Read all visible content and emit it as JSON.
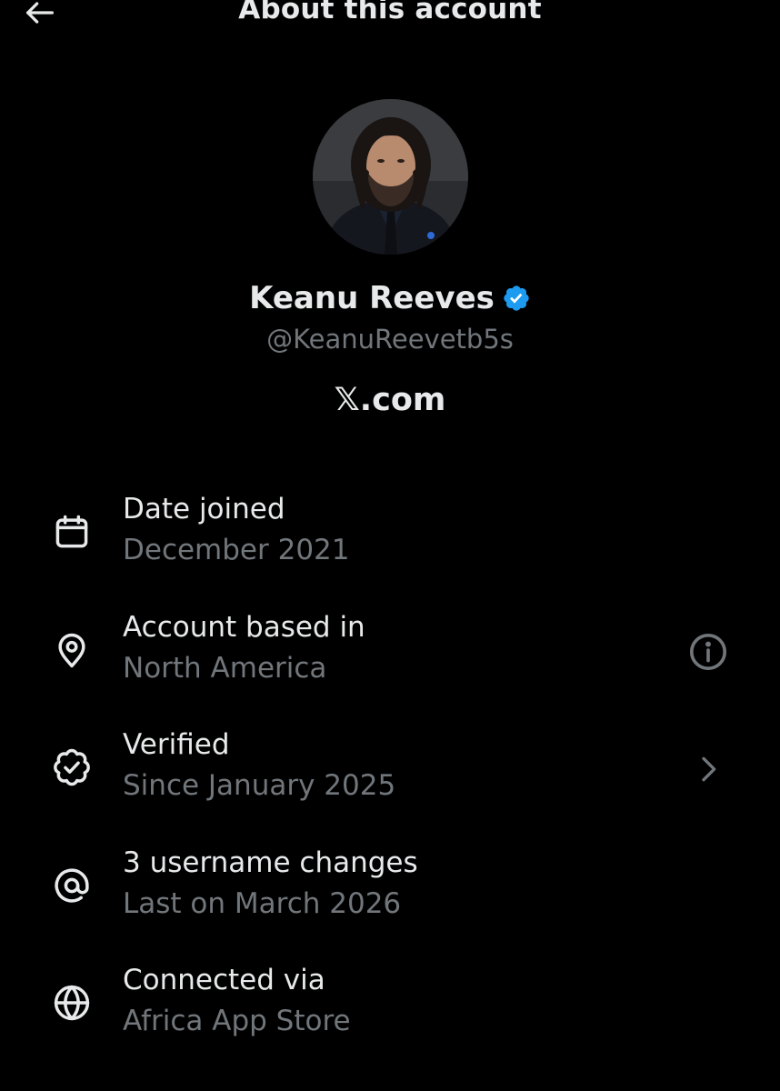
{
  "header": {
    "title": "About this account",
    "back_icon": "arrow-left-icon"
  },
  "profile": {
    "display_name": "Keanu Reeves",
    "verified_icon": "verified-badge-icon",
    "verified_color": "#1d9bf0",
    "handle": "@KeanuReevetb5s",
    "website": "𝕏.com"
  },
  "details": [
    {
      "icon": "calendar-icon",
      "title": "Date joined",
      "subtitle": "December 2021"
    },
    {
      "icon": "location-pin-icon",
      "title": "Account based in",
      "subtitle": "North America",
      "action_icon": "info-icon"
    },
    {
      "icon": "verified-outline-icon",
      "title": "Verified",
      "subtitle": "Since January 2025",
      "action_icon": "chevron-right-icon"
    },
    {
      "icon": "at-sign-icon",
      "title": "3 username changes",
      "subtitle": "Last on March 2026"
    },
    {
      "icon": "globe-icon",
      "title": "Connected via",
      "subtitle": "Africa App Store"
    }
  ],
  "colors": {
    "background": "#000000",
    "primary_text": "#e7e9ea",
    "secondary_text": "#71767b"
  }
}
